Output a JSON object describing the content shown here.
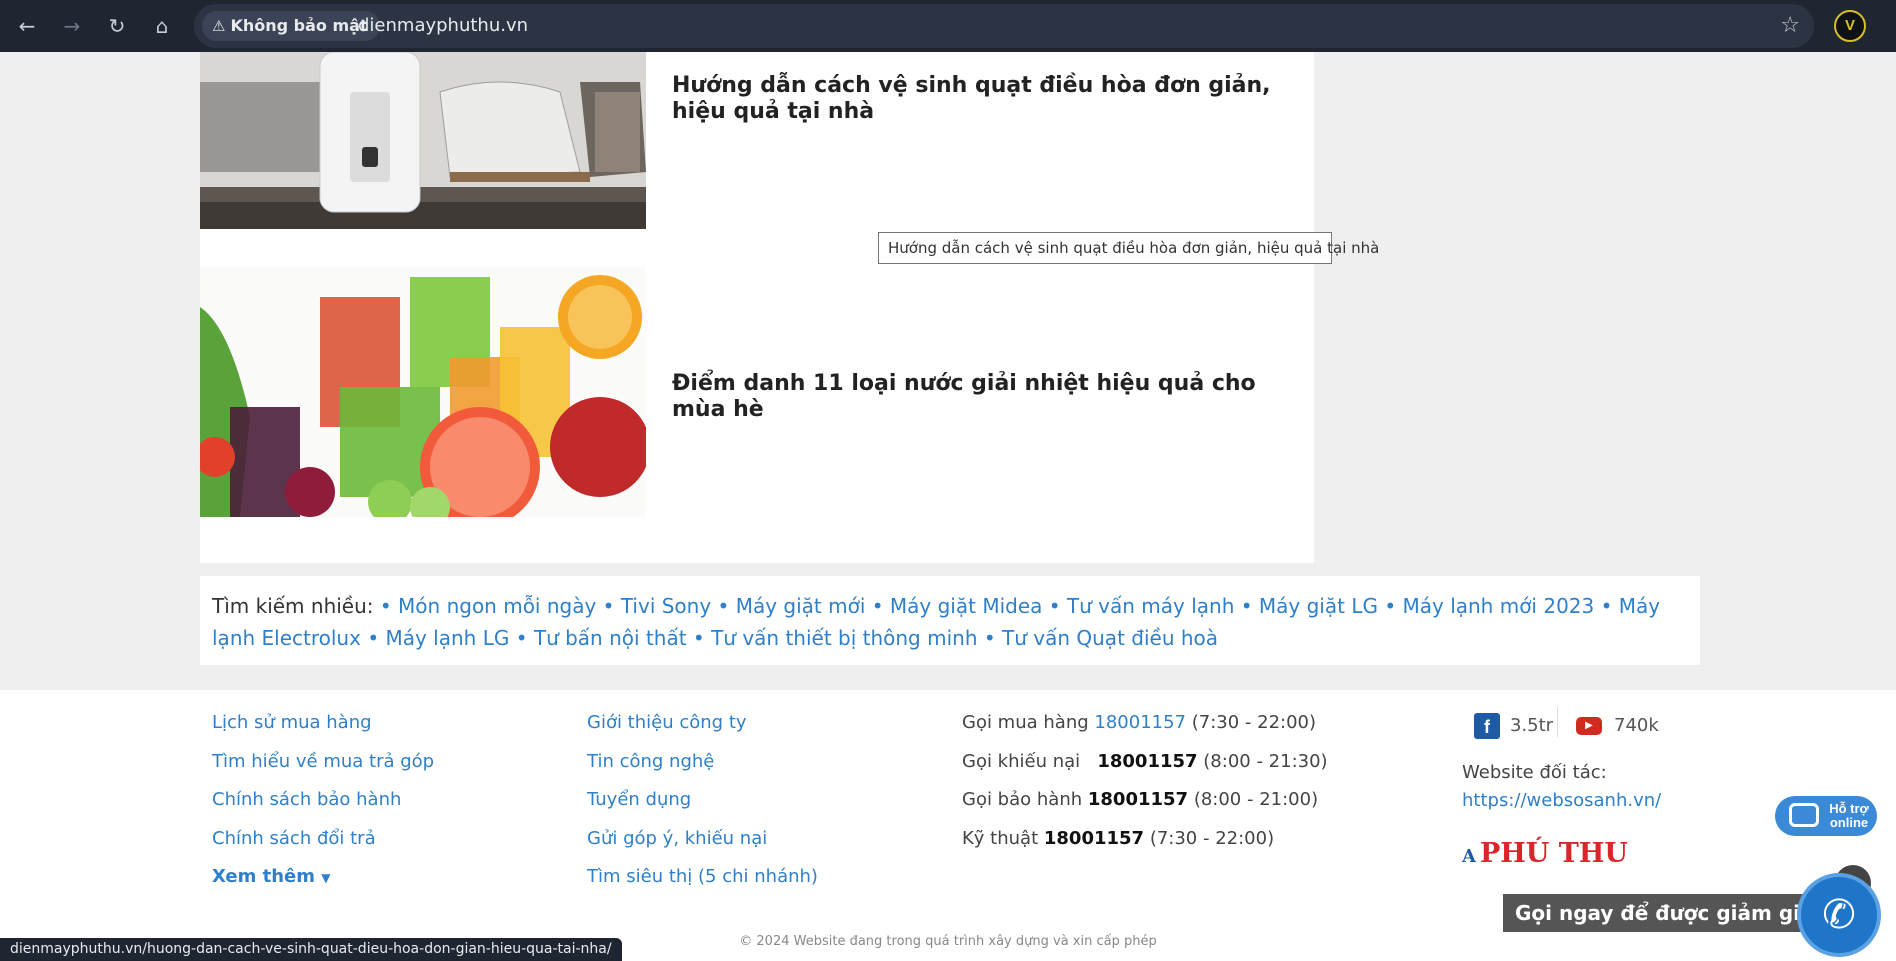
{
  "browser": {
    "security_label": "Không bảo mật",
    "url": "dienmayphuthu.vn",
    "status_url": "dienmayphuthu.vn/huong-dan-cach-ve-sinh-quat-dieu-hoa-don-gian-hieu-qua-tai-nha/"
  },
  "articles": [
    {
      "title": "Hướng dẫn cách vệ sinh quạt điều hòa đơn giản, hiệu quả tại nhà",
      "image": "air-cooler-photo"
    },
    {
      "title": "Điểm danh 11 loại nước giải nhiệt hiệu quả cho mùa hè",
      "image": "juice-fruits-photo"
    }
  ],
  "tooltip": "Hướng dẫn cách vệ sinh quạt điều hòa đơn giản, hiệu quả tại nhà",
  "search": {
    "label": "Tìm kiếm nhiều:",
    "tags": [
      "Món ngon mỗi ngày",
      "Tivi Sony",
      "Máy giặt mới",
      "Máy giặt Midea",
      "Tư vấn máy lạnh",
      "Máy giặt LG",
      "Máy lạnh mới 2023",
      "Máy lạnh Electrolux",
      "Máy lạnh LG",
      "Tư bấn nội thất",
      "Tư vấn thiết bị thông minh",
      "Tư vấn Quạt điều hoà"
    ]
  },
  "footer": {
    "col1": [
      "Lịch sử mua hàng",
      "Tìm hiểu về mua trả góp",
      "Chính sách bảo hành",
      "Chính sách đổi trả"
    ],
    "more": "Xem thêm",
    "col2": [
      "Giới thiệu công ty",
      "Tin công nghệ",
      "Tuyển dụng",
      "Gửi góp ý, khiếu nại",
      "Tìm siêu thị (5 chi nhánh)"
    ],
    "contacts": [
      {
        "label": "Gọi mua hàng",
        "phone": "18001157",
        "hours": "(7:30 - 22:00)"
      },
      {
        "label": "Gọi khiếu nại",
        "phone": "18001157",
        "hours": "(8:00 - 21:30)"
      },
      {
        "label": "Gọi bảo hành",
        "phone": "18001157",
        "hours": "(8:00 - 21:00)"
      },
      {
        "label": "Kỹ thuật",
        "phone": "18001157",
        "hours": "(7:30 - 22:00)"
      }
    ],
    "facebook_count": "3.5tr",
    "youtube_count": "740k",
    "partner_label": "Website đối tác:",
    "partner_url": "https://websosanh.vn/",
    "brand": "PHÚ THU",
    "copyright": "© 2024 Website đang trong quá trình xây dựng và xin cấp phép"
  },
  "widgets": {
    "support_line1": "Hỗ trợ",
    "support_line2": "online",
    "call_tip": "Gọi ngay để được giảm giá"
  },
  "colors": {
    "link": "#2f80c9",
    "brand_red": "#d9262b",
    "chrome_bg": "#1f2531"
  }
}
